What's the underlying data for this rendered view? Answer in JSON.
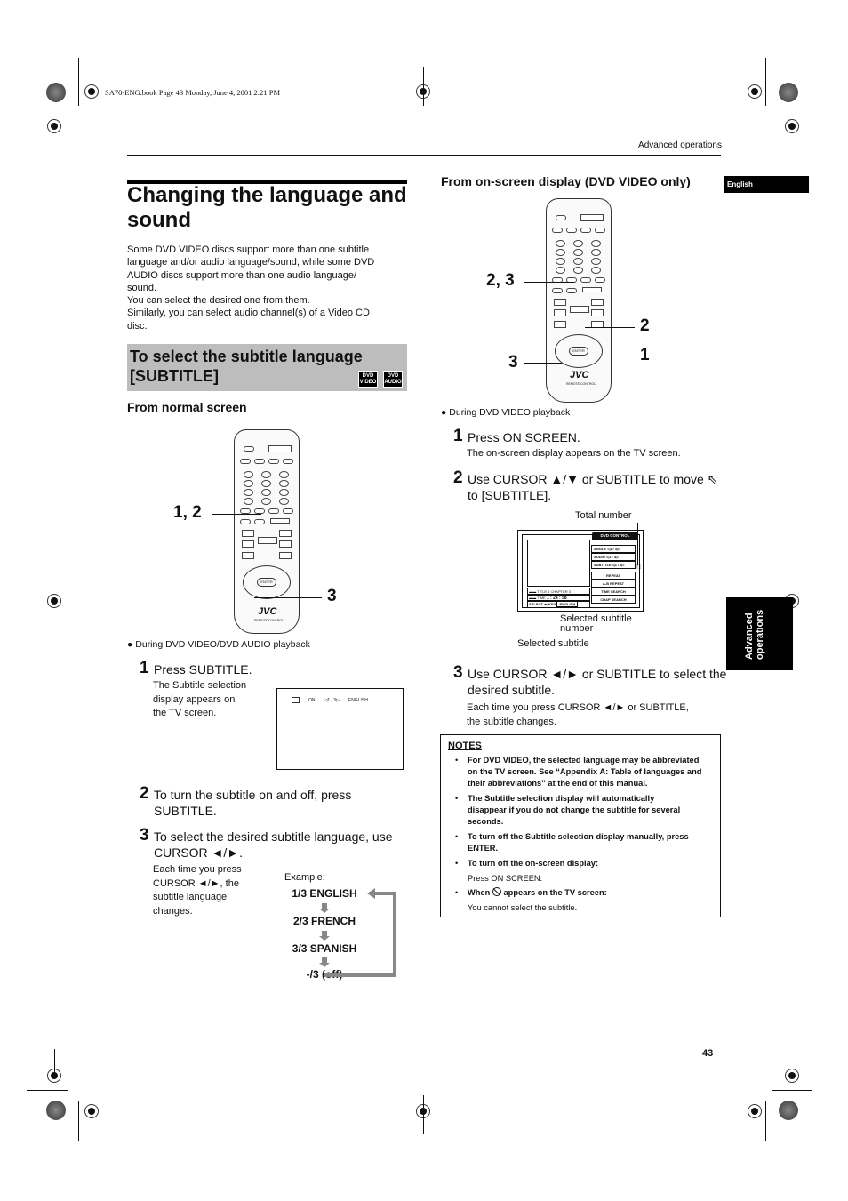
{
  "book_line": "SA70-ENG.book  Page 43  Monday, June 4, 2001  2:21 PM",
  "header": {
    "section": "Advanced operations"
  },
  "tabs": {
    "language": "English",
    "side_line1": "Advanced",
    "side_line2": "operations"
  },
  "title": "Changing the language and sound",
  "intro": [
    "Some DVD VIDEO discs support more than one subtitle",
    "language and/or audio language/sound, while some DVD",
    "AUDIO discs support more than one audio language/",
    "sound.",
    "You can select the desired one from them.",
    "Similarly, you can select audio channel(s) of a Video CD",
    "disc."
  ],
  "subtitle_section": {
    "title_line1": "To select the subtitle language",
    "title_line2": "[SUBTITLE]",
    "badges": [
      {
        "top": "DVD",
        "bottom": "VIDEO"
      },
      {
        "top": "DVD",
        "bottom": "AUDIO"
      }
    ]
  },
  "normal_screen": {
    "heading": "From normal screen",
    "callouts": [
      "1, 2",
      "3"
    ],
    "playback_note": "During DVD VIDEO/DVD AUDIO playback",
    "steps": [
      {
        "num": "1",
        "text": "Press SUBTITLE.",
        "detail": [
          "The Subtitle selection",
          "display appears on",
          "the TV screen."
        ]
      },
      {
        "num": "2",
        "text_line1": "To turn the subtitle on and off, press",
        "text_line2": "SUBTITLE."
      },
      {
        "num": "3",
        "text_line1": "To select the desired subtitle language, use",
        "text_line2": "CURSOR ◄/►.",
        "detail": [
          "Each time you press",
          "CURSOR ◄/►, the",
          "subtitle language",
          "changes."
        ]
      }
    ],
    "tv_display": {
      "status": "ON",
      "selector": "◁1 / 3▷",
      "language": "ENGLISH"
    },
    "example": {
      "label": "Example:",
      "items": [
        "1/3 ENGLISH",
        "2/3 FRENCH",
        "3/3 SPANISH",
        "-/3 (off)"
      ]
    }
  },
  "onscreen": {
    "heading": "From on-screen display (DVD VIDEO only)",
    "callouts": [
      "2, 3",
      "2",
      "3",
      "1"
    ],
    "playback_note": "During DVD VIDEO playback",
    "steps": [
      {
        "num": "1",
        "text": "Press ON SCREEN.",
        "detail": "The on-screen display appears on the TV screen."
      },
      {
        "num": "2",
        "text_line1": "Use CURSOR ▲/▼ or SUBTITLE to move ⇖",
        "text_line2": "to [SUBTITLE]."
      },
      {
        "num": "3",
        "text_line1": "Use CURSOR ◄/► or SUBTITLE to select the",
        "text_line2": "desired subtitle.",
        "detail": [
          "Each time you press CURSOR ◄/► or SUBTITLE,",
          "the subtitle changes."
        ]
      }
    ],
    "osd": {
      "tab": "DVD CONTROL",
      "items": [
        {
          "label": "ANGLE",
          "value": "1 / 3"
        },
        {
          "label": "AUDIO",
          "value": "1 / 3"
        },
        {
          "label": "SUBTITLE",
          "value": "1 / 3"
        }
      ],
      "buttons": [
        "REPEAT",
        "A-B REPEAT",
        "TIME SEARCH",
        "CHAP SEARCH"
      ],
      "status": {
        "title": "TITLE",
        "title_val": "1",
        "chapter": "CHAPTER",
        "chapter_val": "3",
        "time_label": "TIME",
        "time": "1 : 24 : 58"
      },
      "select_bar": {
        "label": "SELECT",
        "key": "KEY",
        "value": "ENGLISH"
      }
    },
    "annotations": {
      "total_number": "Total number",
      "selected_subtitle_number_line1": "Selected subtitle",
      "selected_subtitle_number_line2": "number",
      "selected_subtitle": "Selected subtitle"
    }
  },
  "remote": {
    "brand": "JVC",
    "sub": "REMOTE CONTROL",
    "enter": "ENTER"
  },
  "notes": {
    "title": "NOTES",
    "items": [
      {
        "bold": [
          "For DVD VIDEO, the selected language may be abbreviated",
          "on the TV screen.  See “Appendix A: Table of languages and",
          "their abbreviations” at the end of this manual."
        ]
      },
      {
        "bold": [
          "The Subtitle selection display will automatically",
          "disappear if you do not change the subtitle for several",
          "seconds."
        ]
      },
      {
        "bold": [
          "To turn off the Subtitle selection display manually, press",
          "ENTER."
        ]
      },
      {
        "bold": [
          "To turn off the on-screen display:"
        ],
        "plain": "Press ON SCREEN."
      },
      {
        "bold_pre": "When",
        "bold_post": "appears on the TV screen:",
        "plain": "You cannot select the subtitle."
      }
    ]
  },
  "page_number": "43"
}
